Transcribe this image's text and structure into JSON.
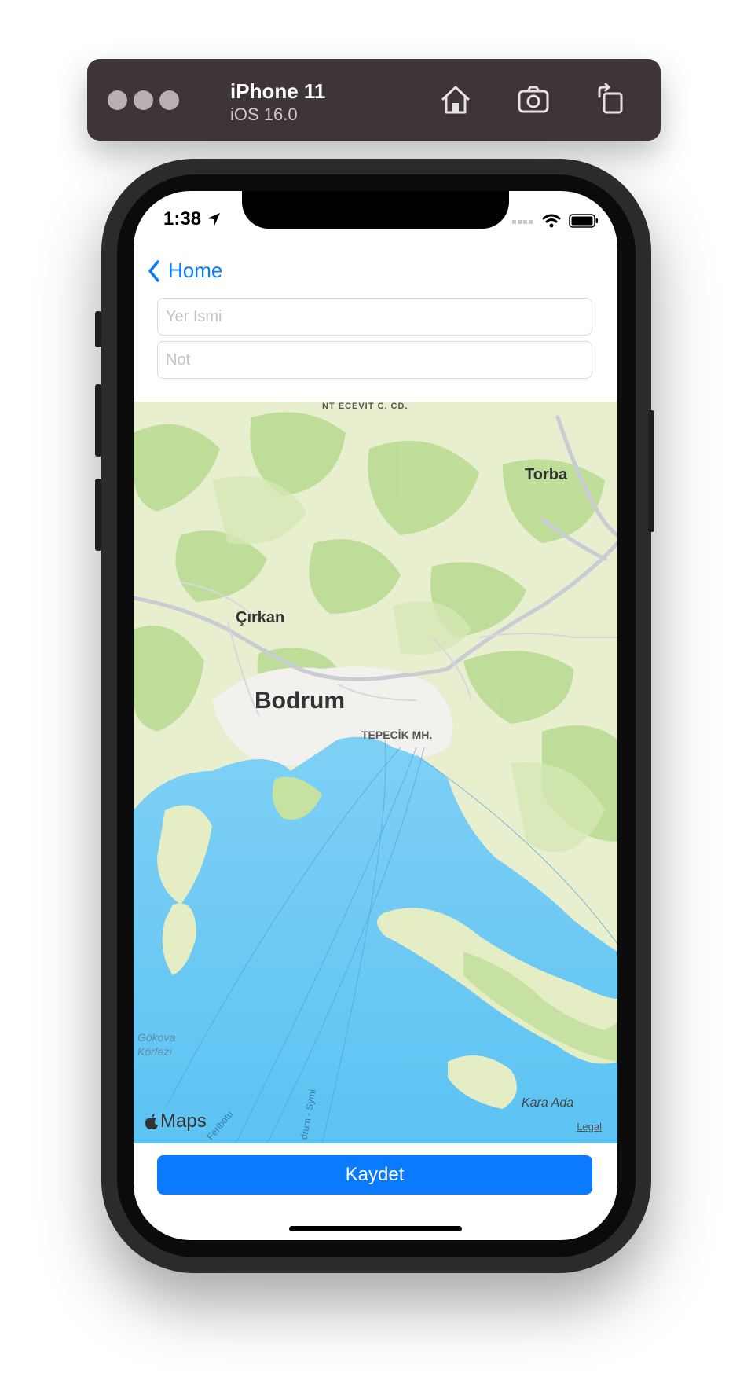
{
  "simulator": {
    "device_name": "iPhone 11",
    "os_version": "iOS 16.0",
    "toolbar_icons": [
      "home-icon",
      "screenshot-icon",
      "rotate-icon"
    ]
  },
  "status_bar": {
    "time": "1:38"
  },
  "nav": {
    "back_label": "Home"
  },
  "form": {
    "name_placeholder": "Yer Ismi",
    "note_placeholder": "Not"
  },
  "map": {
    "labels": {
      "top_road": "NT ECEVIT C. CD.",
      "torba": "Torba",
      "cirkan": "Çırkan",
      "bodrum": "Bodrum",
      "tepecik": "TEPECİK MH.",
      "gokova": "Gökova\nKörfezi",
      "kara_ada": "Kara Ada",
      "feribotu": "Feribotu",
      "bodrum_symi": "drum - Symi"
    },
    "attribution": "Maps",
    "legal": "Legal"
  },
  "actions": {
    "save_label": "Kaydet"
  }
}
